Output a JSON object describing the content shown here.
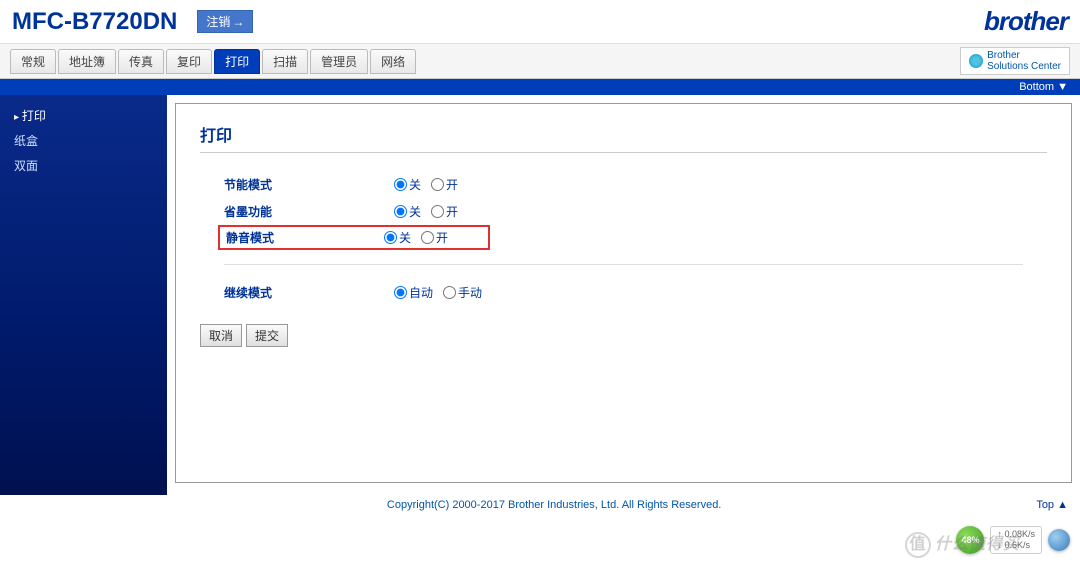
{
  "header": {
    "model": "MFC-B7720DN",
    "logout": "注销",
    "brand": "brother"
  },
  "solutions_center": {
    "line1": "Brother",
    "line2": "Solutions Center"
  },
  "tabs": [
    "常规",
    "地址簿",
    "传真",
    "复印",
    "打印",
    "扫描",
    "管理员",
    "网络"
  ],
  "active_tab_index": 4,
  "bottom_link": "Bottom ▼",
  "top_link": "Top ▲",
  "sidebar": {
    "items": [
      {
        "label": "打印",
        "active": true
      },
      {
        "label": "纸盒",
        "active": false
      },
      {
        "label": "双面",
        "active": false
      }
    ]
  },
  "page": {
    "title": "打印",
    "rows": [
      {
        "label": "节能模式",
        "options": [
          {
            "text": "关",
            "selected": true
          },
          {
            "text": "开",
            "selected": false
          }
        ],
        "highlighted": false
      },
      {
        "label": "省墨功能",
        "options": [
          {
            "text": "关",
            "selected": true
          },
          {
            "text": "开",
            "selected": false
          }
        ],
        "highlighted": false
      },
      {
        "label": "静音模式",
        "options": [
          {
            "text": "关",
            "selected": true
          },
          {
            "text": "开",
            "selected": false
          }
        ],
        "highlighted": true
      },
      {
        "label": "继续模式",
        "options": [
          {
            "text": "自动",
            "selected": true
          },
          {
            "text": "手动",
            "selected": false
          }
        ],
        "highlighted": false
      }
    ],
    "buttons": {
      "cancel": "取消",
      "submit": "提交"
    }
  },
  "footer": {
    "copyright": "Copyright(C) 2000-2017 Brother Industries, Ltd. All Rights Reserved."
  },
  "floaters": {
    "percent": "48%",
    "up": "0.08K/s",
    "down": "0.6K/s"
  },
  "watermark": "什么值得买"
}
